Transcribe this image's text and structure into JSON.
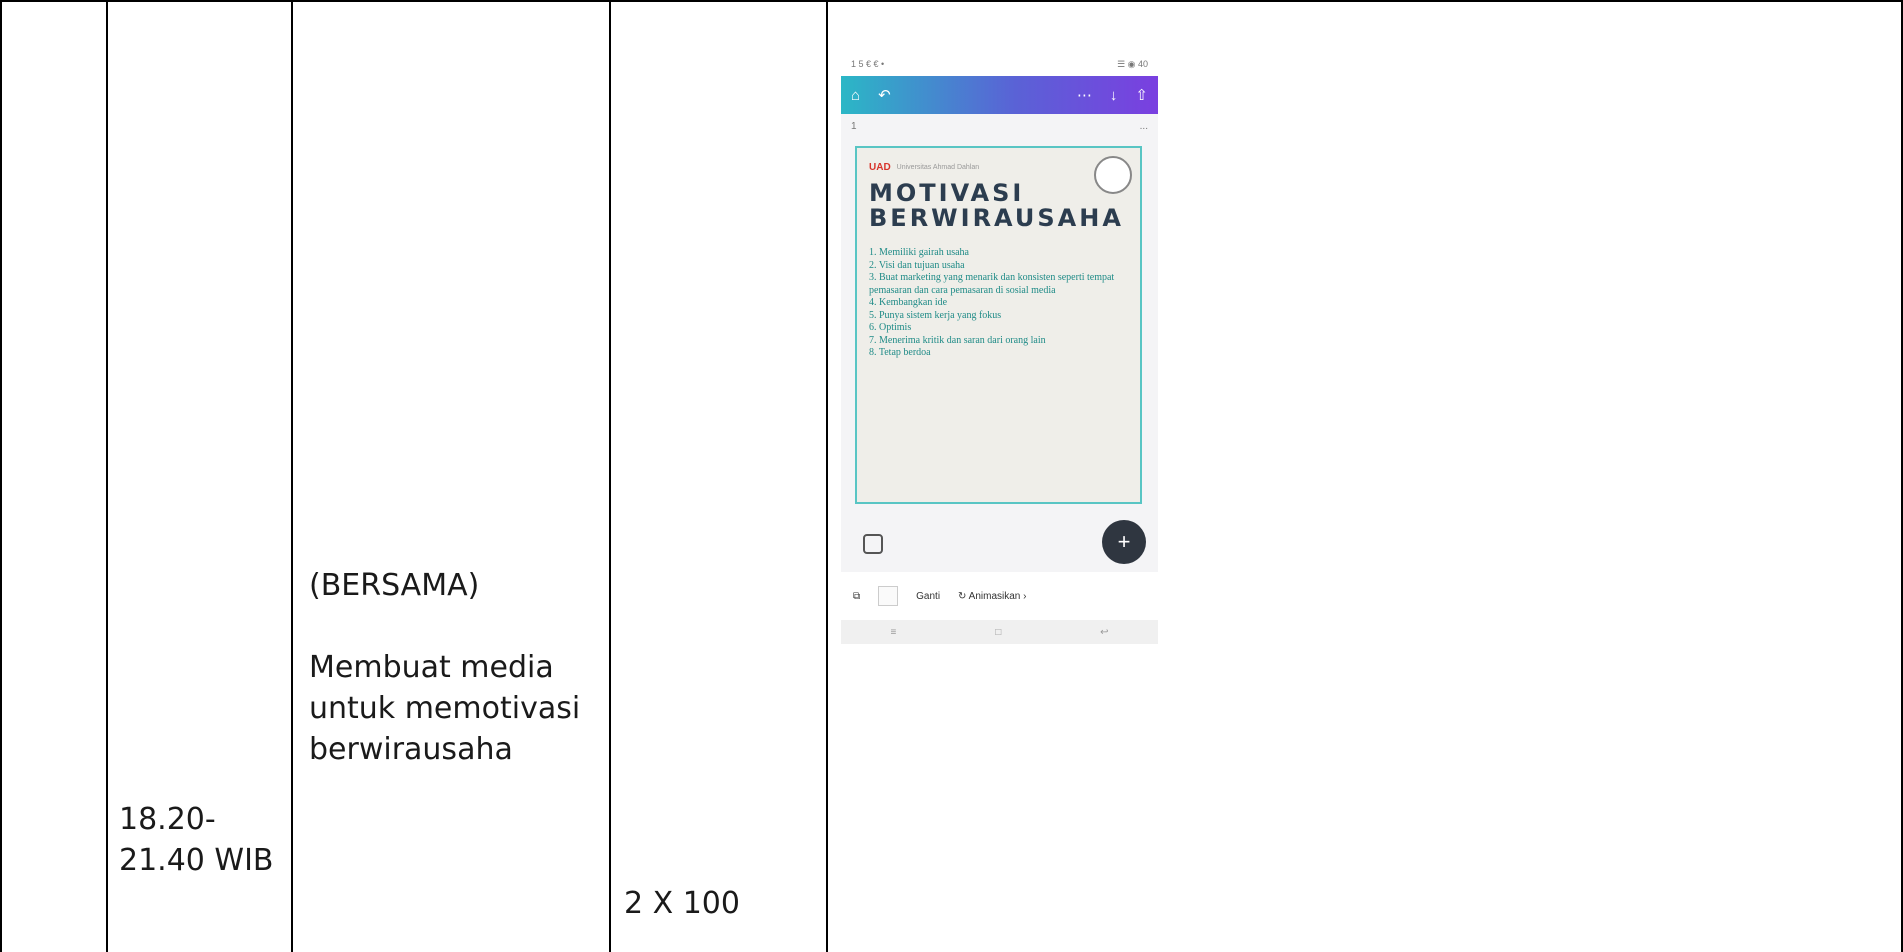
{
  "table": {
    "time": [
      "18.20-",
      "21.40 WIB"
    ],
    "activity": [
      "(BERSAMA)",
      "Membuat media",
      "untuk memotivasi",
      "berwirausaha"
    ],
    "volume": "2 X 100"
  },
  "phone": {
    "status_left": "1 5 € € •",
    "status_right": "☰ ◉ 40",
    "toolbar_icons": [
      "home-icon",
      "undo-icon",
      "more-icon",
      "download-icon",
      "share-icon"
    ],
    "page_number": "1",
    "page_menu": "...",
    "design": {
      "brand": "UAD",
      "brand_sub": "Universitas Ahmad Dahlan",
      "title_line1": "MOTIVASI",
      "title_line2": "BERWIRAUSAHA",
      "list": [
        "1. Memiliki gairah usaha",
        "2. Visi dan tujuan usaha",
        "3. Buat marketing yang menarik dan konsisten seperti tempat pemasaran dan cara pemasaran di sosial media",
        "4. Kembangkan ide",
        "5. Punya sistem kerja yang fokus",
        "6. Optimis",
        "7. Menerima kritik dan saran dari orang lain",
        "8. Tetap berdoa"
      ]
    },
    "bottom": {
      "label_ganti": "Ganti",
      "label_animasi": "Animasikan",
      "arrow": "›"
    }
  }
}
